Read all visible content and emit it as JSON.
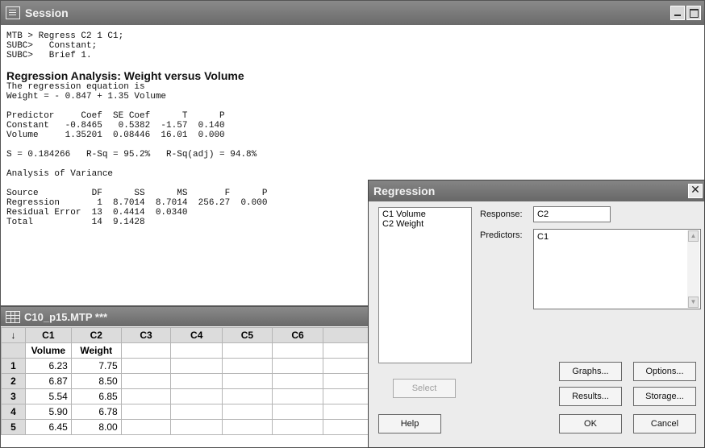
{
  "session": {
    "title": "Session",
    "commands": [
      "MTB > Regress C2 1 C1;",
      "SUBC>   Constant;",
      "SUBC>   Brief 1."
    ],
    "heading": "Regression Analysis: Weight versus Volume",
    "equation_lines": [
      "The regression equation is",
      "Weight = - 0.847 + 1.35 Volume"
    ],
    "coef_table": [
      "Predictor     Coef  SE Coef      T      P",
      "Constant   -0.8465   0.5382  -1.57  0.140",
      "Volume     1.35201  0.08446  16.01  0.000"
    ],
    "fit_line": "S = 0.184266   R-Sq = 95.2%   R-Sq(adj) = 94.8%",
    "anova_title": "Analysis of Variance",
    "anova_table": [
      "Source          DF      SS      MS       F      P",
      "Regression       1  8.7014  8.7014  256.27  0.000",
      "Residual Error  13  0.4414  0.0340",
      "Total           14  9.1428"
    ]
  },
  "worksheet": {
    "title": "C10_p15.MTP ***",
    "corner": "↓",
    "columns": [
      "C1",
      "C2",
      "C3",
      "C4",
      "C5",
      "C6",
      ""
    ],
    "names": [
      "Volume",
      "Weight",
      "",
      "",
      "",
      "",
      ""
    ],
    "rows": [
      {
        "n": "1",
        "c1": "6.23",
        "c2": "7.75"
      },
      {
        "n": "2",
        "c1": "6.87",
        "c2": "8.50"
      },
      {
        "n": "3",
        "c1": "5.54",
        "c2": "6.85"
      },
      {
        "n": "4",
        "c1": "5.90",
        "c2": "6.78"
      },
      {
        "n": "5",
        "c1": "6.45",
        "c2": "8.00"
      }
    ]
  },
  "dialog": {
    "title": "Regression",
    "close": "✕",
    "variables": [
      "C1   Volume",
      "C2   Weight"
    ],
    "response_label": "Response:",
    "response_value": "C2",
    "predictors_label": "Predictors:",
    "predictors_value": "C1",
    "select": "Select",
    "help": "Help",
    "graphs": "Graphs...",
    "options": "Options...",
    "results": "Results...",
    "storage": "Storage...",
    "ok": "OK",
    "cancel": "Cancel"
  }
}
